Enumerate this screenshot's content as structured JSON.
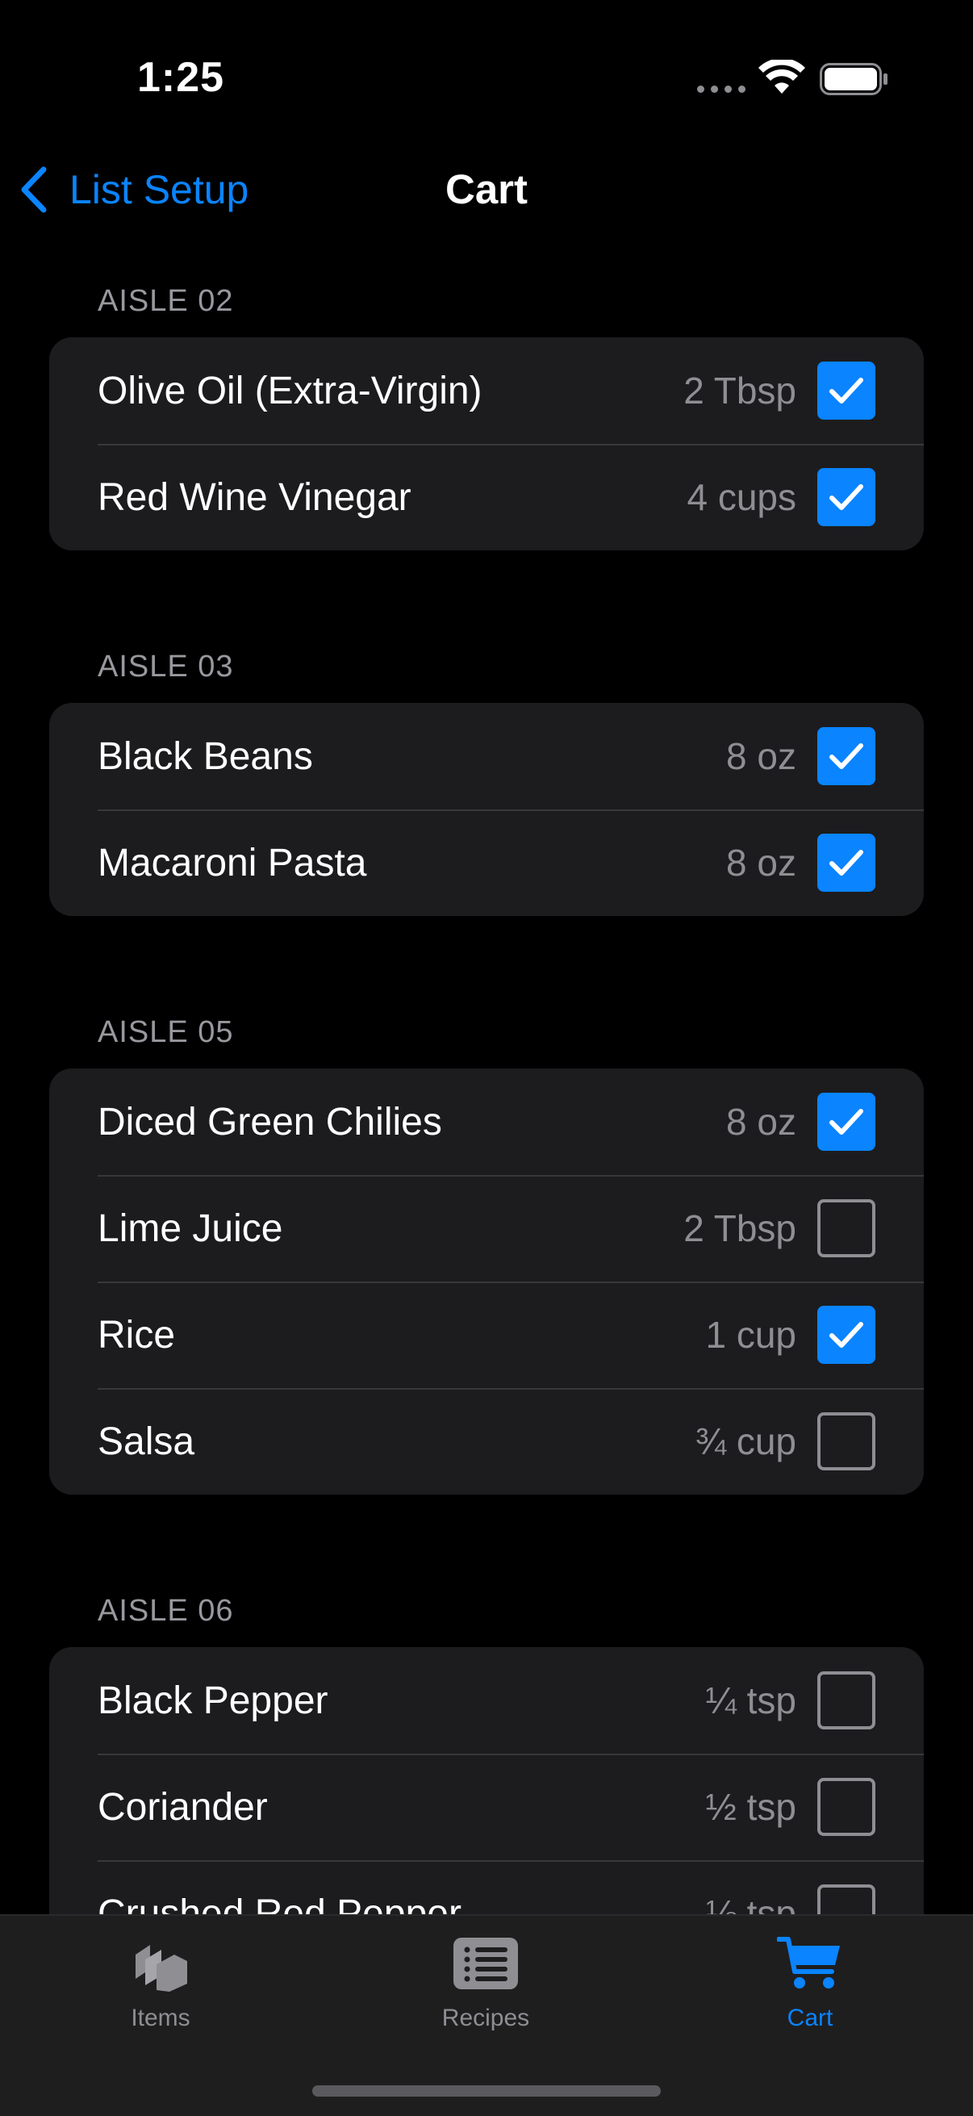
{
  "status": {
    "time": "1:25"
  },
  "nav": {
    "back_label": "List Setup",
    "title": "Cart"
  },
  "colors": {
    "accent": "#0a84ff",
    "row_bg": "#1c1c1e",
    "secondary_text": "#8e8e93"
  },
  "sections": [
    {
      "header": "AISLE 02",
      "items": [
        {
          "name": "Olive Oil (Extra-Virgin)",
          "qty": "2 Tbsp",
          "checked": true
        },
        {
          "name": "Red Wine Vinegar",
          "qty": "4 cups",
          "checked": true
        }
      ]
    },
    {
      "header": "AISLE 03",
      "items": [
        {
          "name": "Black Beans",
          "qty": "8 oz",
          "checked": true
        },
        {
          "name": "Macaroni Pasta",
          "qty": "8 oz",
          "checked": true
        }
      ]
    },
    {
      "header": "AISLE 05",
      "items": [
        {
          "name": "Diced Green Chilies",
          "qty": "8 oz",
          "checked": true
        },
        {
          "name": "Lime Juice",
          "qty": "2 Tbsp",
          "checked": false
        },
        {
          "name": "Rice",
          "qty": "1 cup",
          "checked": true
        },
        {
          "name": "Salsa",
          "qty": "¾ cup",
          "checked": false
        }
      ]
    },
    {
      "header": "AISLE 06",
      "items": [
        {
          "name": "Black Pepper",
          "qty": "¼ tsp",
          "checked": false
        },
        {
          "name": "Coriander",
          "qty": "½ tsp",
          "checked": false
        },
        {
          "name": "Crushed Red Pepper",
          "qty": "⅛ tsp",
          "checked": false
        }
      ]
    }
  ],
  "tabbar": {
    "items_label": "Items",
    "recipes_label": "Recipes",
    "cart_label": "Cart",
    "active_tab": "Cart",
    "items_icon": "stack-icon",
    "recipes_icon": "list-icon",
    "cart_icon": "cart-icon"
  }
}
